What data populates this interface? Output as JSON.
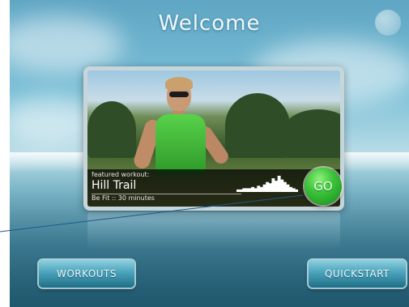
{
  "header": {
    "title": "Welcome",
    "corner_icon": "globe-icon"
  },
  "featured": {
    "label": "featured workout:",
    "name": "Hill Trail",
    "meta": "Be Fit :: 30 minutes",
    "go_label": "GO",
    "elevation_profile": [
      2,
      2,
      3,
      3,
      3,
      4,
      3,
      5,
      4,
      6,
      8,
      7,
      11,
      9,
      13,
      10,
      8,
      6,
      4,
      3,
      2
    ]
  },
  "buttons": {
    "workouts": "WORKOUTS",
    "quickstart": "QUICKSTART"
  },
  "colors": {
    "go": "#3cc43a",
    "button": "#4aa3bb",
    "sky": "#7cc0d7"
  }
}
